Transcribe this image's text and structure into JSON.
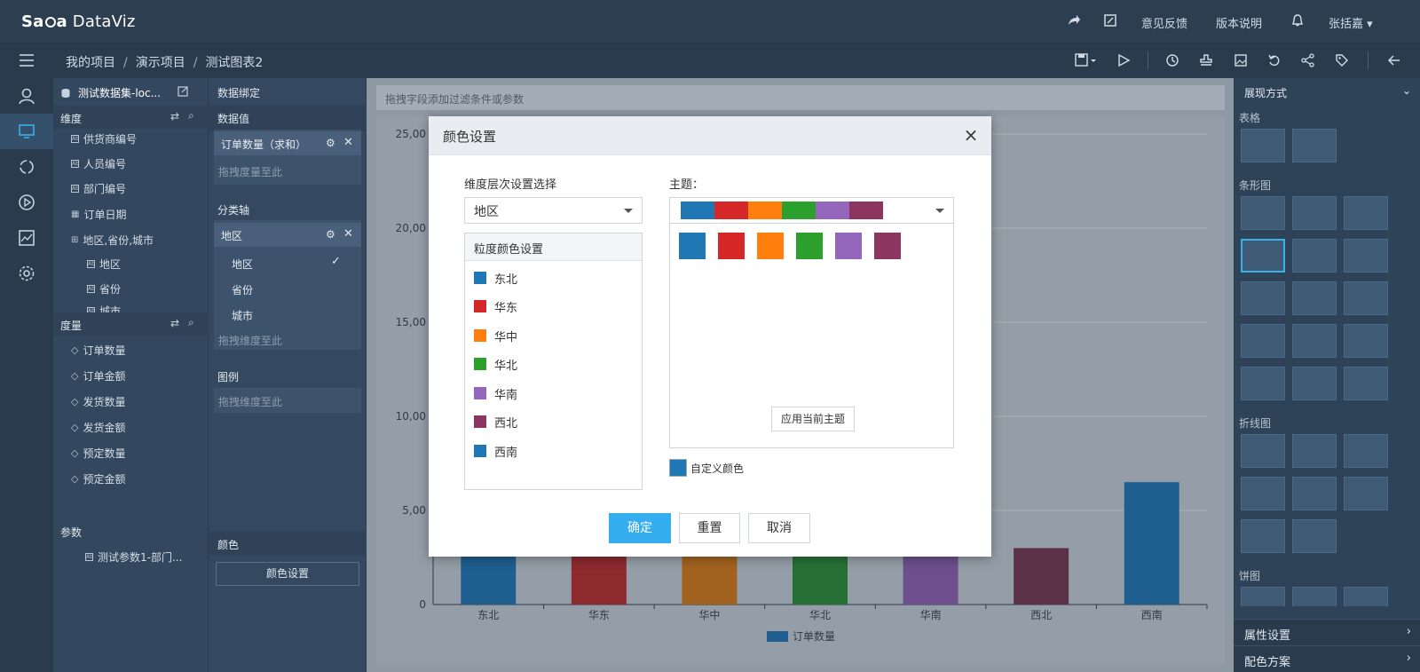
{
  "app": {
    "logo_prefix": "Sa",
    "logo_mid": "a",
    "logo_suffix": "DataViz"
  },
  "topnav": {
    "feedback": "意见反馈",
    "release_notes": "版本说明",
    "user": "张括嘉"
  },
  "breadcrumb": [
    "我的项目",
    "演示项目",
    "测试图表2"
  ],
  "breadcrumb_sep": "/",
  "field_panel": {
    "dataset": "测试数据集-loc...",
    "dimension_label": "维度",
    "dimensions": [
      "供货商编号",
      "人员编号",
      "部门编号",
      "订单日期",
      "地区,省份,城市",
      "地区",
      "省份",
      "城市"
    ],
    "measure_label": "度量",
    "measures": [
      "订单数量",
      "订单金额",
      "发货数量",
      "发货金额",
      "预定数量",
      "预定金额"
    ],
    "param_label": "参数",
    "params": [
      "测试参数1-部门..."
    ]
  },
  "binding_panel": {
    "title": "数据绑定",
    "value_label": "数据值",
    "value_pill": "订单数量（求和）",
    "drop_measure": "拖拽度量至此",
    "axis_label": "分类轴",
    "axis_pill": "地区",
    "axis_levels": [
      "地区",
      "省份",
      "城市"
    ],
    "drop_dimension": "拖拽维度至此",
    "legend_label": "图例",
    "legend_drop": "拖拽维度至此",
    "color_label": "颜色",
    "color_button": "颜色设置"
  },
  "filter_bar": {
    "placeholder": "拖拽字段添加过滤条件或参数"
  },
  "right_panel": {
    "title": "展现方式",
    "sections": [
      "表格",
      "条形图",
      "折线图",
      "饼图"
    ],
    "bottom": [
      "属性设置",
      "配色方案"
    ]
  },
  "chart_data": {
    "type": "bar",
    "categories": [
      "东北",
      "华东",
      "华中",
      "华北",
      "华南",
      "西北",
      "西南"
    ],
    "series": [
      {
        "name": "订单数量",
        "values": [
          3900,
          3800,
          3700,
          3800,
          3700,
          3000,
          6500
        ]
      }
    ],
    "ylim": [
      0,
      25000
    ],
    "yticks": [
      0,
      5000,
      10000,
      15000,
      20000,
      25000
    ],
    "ytick_labels": [
      "0",
      "5,00",
      "10,00",
      "15,00",
      "20,00",
      "25,00"
    ],
    "colors": [
      "#1f5f8f",
      "#8c2a2e",
      "#a2621f",
      "#267035",
      "#6c4f8c",
      "#5a3147",
      "#1f5f8f"
    ],
    "grid": true,
    "legend": "bottom"
  },
  "dialog": {
    "title": "颜色设置",
    "close": "×",
    "dim_label": "维度层次设置选择",
    "dim_value": "地区",
    "granularity_title": "粒度颜色设置",
    "granularity": [
      {
        "label": "东北",
        "color": "#1f77b4"
      },
      {
        "label": "华东",
        "color": "#d62728"
      },
      {
        "label": "华中",
        "color": "#ff7f0e"
      },
      {
        "label": "华北",
        "color": "#2ca02c"
      },
      {
        "label": "华南",
        "color": "#9467bd"
      },
      {
        "label": "西北",
        "color": "#8c3560"
      },
      {
        "label": "西南",
        "color": "#1f77b4"
      }
    ],
    "theme_label": "主题：",
    "theme_colors": [
      "#1f77b4",
      "#d62728",
      "#ff7f0e",
      "#2ca02c",
      "#9467bd",
      "#8c3560"
    ],
    "apply_theme": "应用当前主题",
    "custom_color": "自定义颜色",
    "custom_swatch": "#1f77b4",
    "ok": "确定",
    "reset": "重置",
    "cancel": "取消"
  }
}
